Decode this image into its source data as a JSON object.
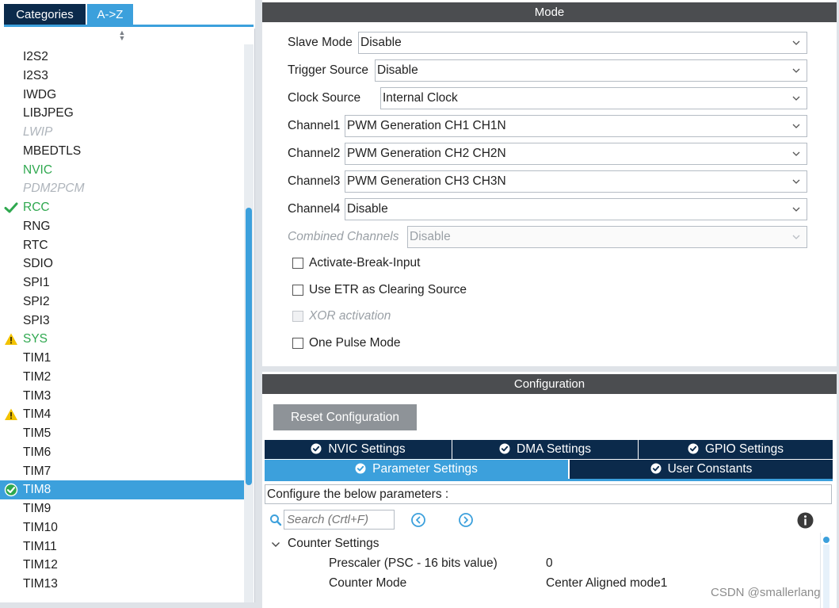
{
  "left_panel": {
    "tabs": [
      {
        "label": "Categories"
      },
      {
        "label": "A->Z"
      }
    ],
    "components": [
      {
        "label": "I2S2",
        "state": "normal"
      },
      {
        "label": "I2S3",
        "state": "normal"
      },
      {
        "label": "IWDG",
        "state": "normal"
      },
      {
        "label": "LIBJPEG",
        "state": "normal"
      },
      {
        "label": "LWIP",
        "state": "disabled"
      },
      {
        "label": "MBEDTLS",
        "state": "normal"
      },
      {
        "label": "NVIC",
        "state": "green"
      },
      {
        "label": "PDM2PCM",
        "state": "disabled"
      },
      {
        "label": "RCC",
        "state": "green",
        "icon": "check-icon"
      },
      {
        "label": "RNG",
        "state": "normal"
      },
      {
        "label": "RTC",
        "state": "normal"
      },
      {
        "label": "SDIO",
        "state": "normal"
      },
      {
        "label": "SPI1",
        "state": "normal"
      },
      {
        "label": "SPI2",
        "state": "normal"
      },
      {
        "label": "SPI3",
        "state": "normal"
      },
      {
        "label": "SYS",
        "state": "green",
        "icon": "warning-icon"
      },
      {
        "label": "TIM1",
        "state": "normal"
      },
      {
        "label": "TIM2",
        "state": "normal"
      },
      {
        "label": "TIM3",
        "state": "normal"
      },
      {
        "label": "TIM4",
        "state": "normal",
        "icon": "warning-icon"
      },
      {
        "label": "TIM5",
        "state": "normal"
      },
      {
        "label": "TIM6",
        "state": "normal"
      },
      {
        "label": "TIM7",
        "state": "normal"
      },
      {
        "label": "TIM8",
        "state": "selected",
        "icon": "check-circle-icon"
      },
      {
        "label": "TIM9",
        "state": "normal"
      },
      {
        "label": "TIM10",
        "state": "normal"
      },
      {
        "label": "TIM11",
        "state": "normal"
      },
      {
        "label": "TIM12",
        "state": "normal"
      },
      {
        "label": "TIM13",
        "state": "normal"
      }
    ]
  },
  "mode": {
    "header": "Mode",
    "fields": [
      {
        "label": "Slave Mode",
        "value": "Disable"
      },
      {
        "label": "Trigger Source",
        "value": "Disable"
      },
      {
        "label": "Clock Source",
        "value": "Internal Clock"
      },
      {
        "label": "Channel1",
        "value": "PWM Generation CH1 CH1N"
      },
      {
        "label": "Channel2",
        "value": "PWM Generation CH2 CH2N"
      },
      {
        "label": "Channel3",
        "value": "PWM Generation CH3 CH3N"
      },
      {
        "label": "Channel4",
        "value": "Disable"
      },
      {
        "label": "Combined Channels",
        "value": "Disable",
        "disabled": true
      }
    ],
    "checkboxes": [
      {
        "label": "Activate-Break-Input",
        "checked": false
      },
      {
        "label": "Use ETR as Clearing Source",
        "checked": false
      },
      {
        "label": "XOR activation",
        "checked": false,
        "disabled": true
      },
      {
        "label": "One Pulse Mode",
        "checked": false
      }
    ]
  },
  "configuration": {
    "header": "Configuration",
    "reset_label": "Reset Configuration",
    "tabs_row1": [
      {
        "label": "NVIC Settings"
      },
      {
        "label": "DMA Settings"
      },
      {
        "label": "GPIO Settings"
      }
    ],
    "tabs_row2": [
      {
        "label": "Parameter Settings",
        "active": true
      },
      {
        "label": "User Constants"
      }
    ],
    "configure_text": "Configure the below parameters :",
    "search_placeholder": "Search (Crtl+F)",
    "group_label": "Counter Settings",
    "params": [
      {
        "name": "Prescaler (PSC - 16 bits value)",
        "value": "0"
      },
      {
        "name": "Counter Mode",
        "value": "Center Aligned mode1"
      }
    ]
  },
  "watermark": "CSDN @smallerlang",
  "colors": {
    "accent": "#3ca0dc",
    "dark_tab": "#0b2a4b",
    "header_gray": "#4b4d50",
    "enabled_green": "#2fa84f",
    "warning_yellow": "#f2c200"
  }
}
